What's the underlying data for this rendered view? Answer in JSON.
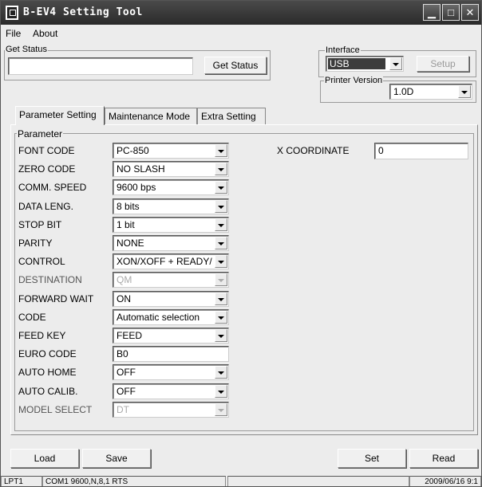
{
  "window": {
    "title": "B-EV4 Setting Tool"
  },
  "menu": [
    "File",
    "About"
  ],
  "get_status": {
    "group_title": "Get Status",
    "field_value": "",
    "button_label": "Get Status"
  },
  "interface": {
    "group_title": "Interface",
    "selected": "USB",
    "setup_label": "Setup"
  },
  "printer_version": {
    "group_title": "Printer Version",
    "selected": "1.0D"
  },
  "tabs": [
    "Parameter Setting",
    "Maintenance Mode",
    "Extra Setting"
  ],
  "parameter": {
    "group_title": "Parameter",
    "rows": [
      {
        "label": "FONT CODE",
        "value": "PC-850",
        "kind": "select"
      },
      {
        "label": "ZERO CODE",
        "value": "NO SLASH",
        "kind": "select"
      },
      {
        "label": "COMM. SPEED",
        "value": "9600 bps",
        "kind": "select"
      },
      {
        "label": "DATA LENG.",
        "value": "8 bits",
        "kind": "select"
      },
      {
        "label": "STOP BIT",
        "value": "1 bit",
        "kind": "select"
      },
      {
        "label": "PARITY",
        "value": "NONE",
        "kind": "select"
      },
      {
        "label": "CONTROL",
        "value": "XON/XOFF + READY/",
        "kind": "select"
      },
      {
        "label": "DESTINATION",
        "value": "QM",
        "kind": "select-disabled"
      },
      {
        "label": "FORWARD WAIT",
        "value": "ON",
        "kind": "select"
      },
      {
        "label": "CODE",
        "value": "Automatic selection",
        "kind": "select"
      },
      {
        "label": "FEED KEY",
        "value": "FEED",
        "kind": "select"
      },
      {
        "label": "EURO CODE",
        "value": "B0",
        "kind": "text"
      },
      {
        "label": "AUTO HOME",
        "value": "OFF",
        "kind": "select"
      },
      {
        "label": "AUTO CALIB.",
        "value": "OFF",
        "kind": "select"
      },
      {
        "label": "MODEL SELECT",
        "value": "DT",
        "kind": "select-disabled"
      }
    ],
    "x_coordinate": {
      "label": "X COORDINATE",
      "value": "0"
    }
  },
  "buttons": {
    "load": "Load",
    "save": "Save",
    "set": "Set",
    "read": "Read"
  },
  "status_bar": {
    "port": "LPT1",
    "comm": "COM1 9600,N,8,1 RTS",
    "middle": "",
    "date": "2009/06/16 9:1"
  }
}
